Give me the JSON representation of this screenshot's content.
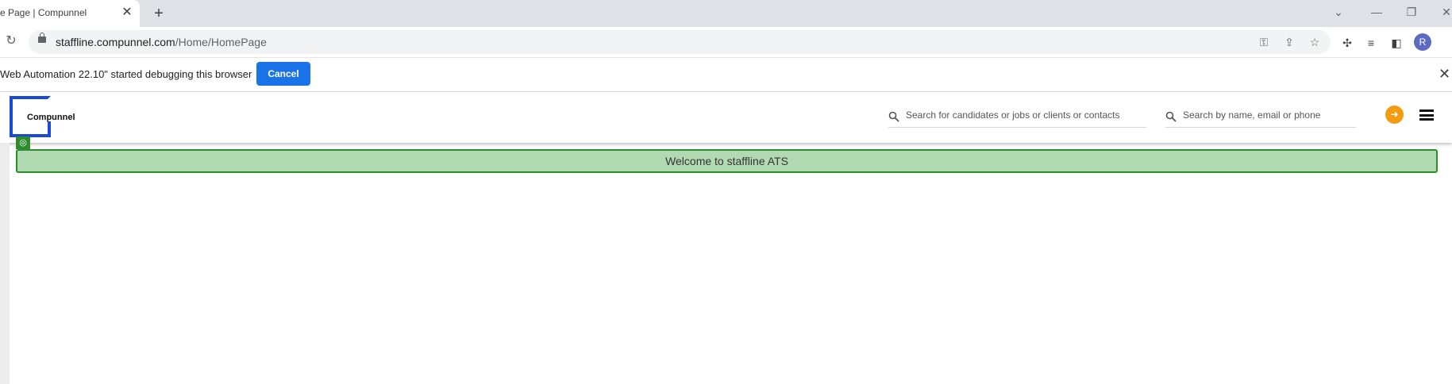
{
  "browser": {
    "tab_title": "e Page | Compunnel",
    "tab_close": "✕",
    "new_tab": "+",
    "url_host": "staffline.compunnel.com",
    "url_path": "/Home/HomePage",
    "profile_initial": "R"
  },
  "infobar": {
    "message": "Web Automation 22.10\" started debugging this browser",
    "cancel_label": "Cancel",
    "close": "✕"
  },
  "app": {
    "logo_text": "Compunnel",
    "global_search_placeholder": "Search for candidates or jobs or clients or contacts",
    "people_search_placeholder": "Search by name, email or phone",
    "welcome_message": "Welcome to staffline ATS"
  },
  "colors": {
    "accent_blue": "#1a73e8",
    "logo_blue": "#1a4bd6",
    "logout_orange": "#f39c12",
    "welcome_bg": "#b2dab2",
    "welcome_border": "#2e8b2e"
  }
}
